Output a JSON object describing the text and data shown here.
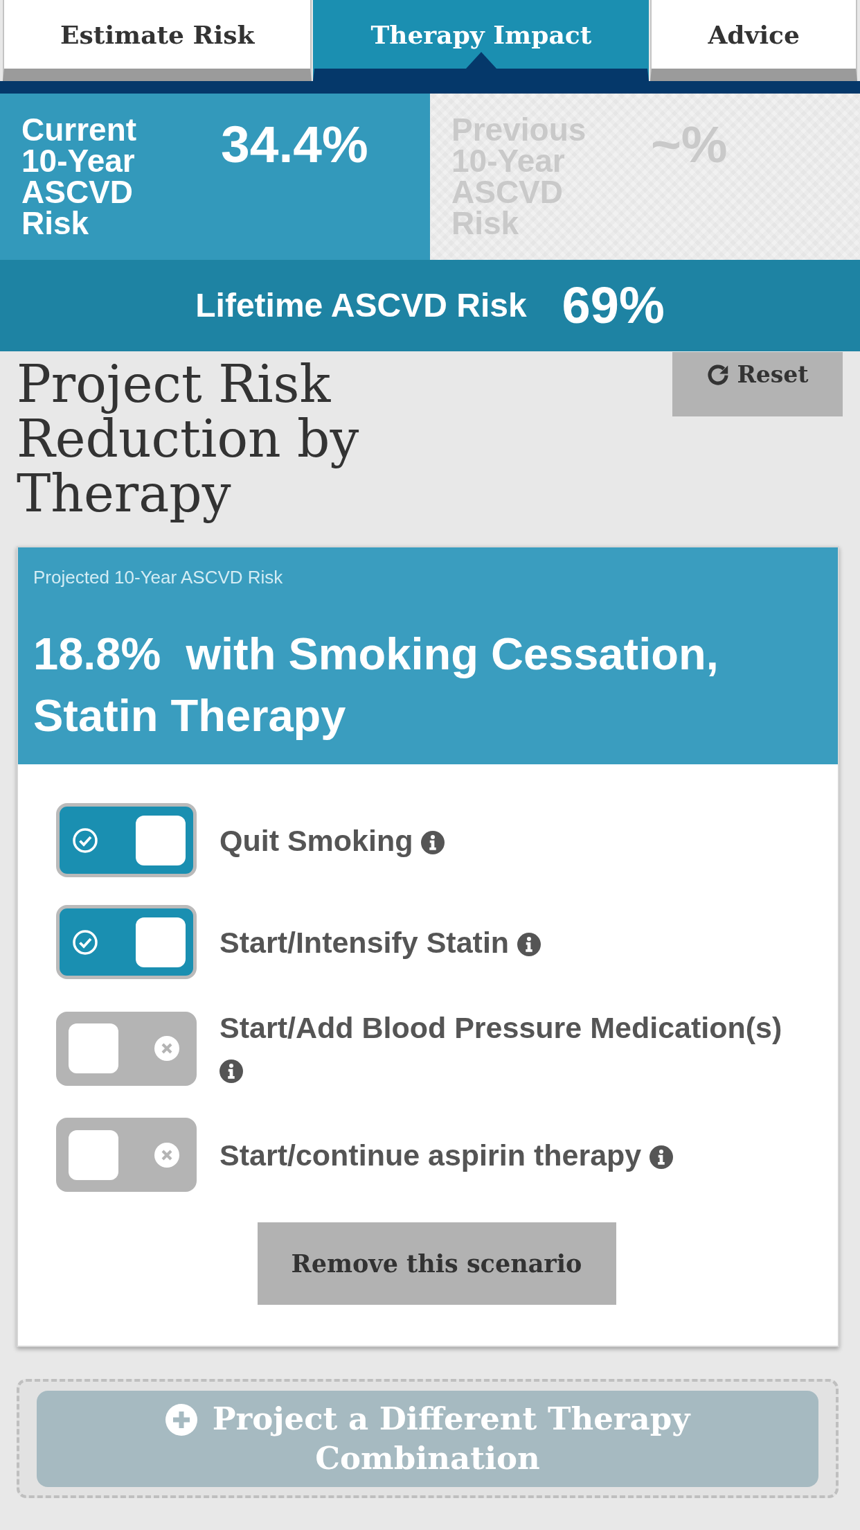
{
  "tabs": [
    {
      "label": "Estimate Risk",
      "selected": false
    },
    {
      "label": "Therapy Impact",
      "selected": true
    },
    {
      "label": "Advice",
      "selected": false
    }
  ],
  "ten_year_risk": [
    {
      "label": "Current 10-Year ASCVD Risk",
      "value": "34.4%",
      "disabled": false
    },
    {
      "label": "Previous 10-Year ASCVD Risk",
      "value": "~%",
      "disabled": true
    }
  ],
  "lifetime_risk": {
    "label": "Lifetime ASCVD Risk",
    "value": "69%"
  },
  "projection": {
    "title": "Project Risk Reduction by Therapy",
    "reset_button": "Reset"
  },
  "scenario": {
    "caption": "Projected 10-Year ASCVD Risk",
    "summary": "18.8%  with Smoking Cessation, Statin Therapy",
    "options": [
      {
        "label": "Quit Smoking",
        "on": true
      },
      {
        "label": "Start/Intensify Statin",
        "on": true
      },
      {
        "label": "Start/Add Blood Pressure Medication(s)",
        "on": false
      },
      {
        "label": "Start/continue aspirin therapy",
        "on": false
      }
    ],
    "remove_button": "Remove this scenario"
  },
  "add_button": "Project a Different Therapy Combination"
}
